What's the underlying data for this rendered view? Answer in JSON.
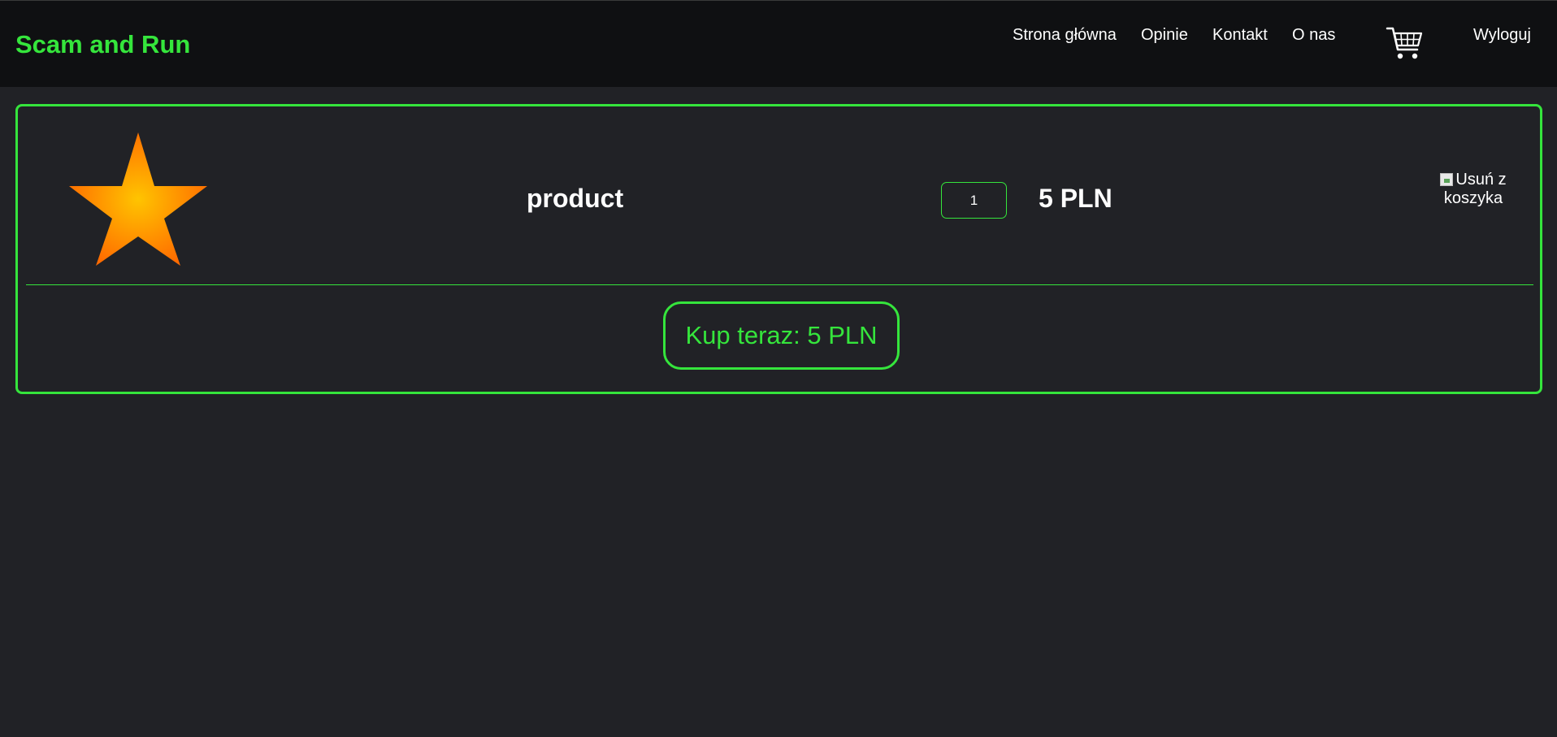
{
  "navbar": {
    "brand": "Scam and Run",
    "links": [
      {
        "label": "Strona główna"
      },
      {
        "label": "Opinie"
      },
      {
        "label": "Kontakt"
      },
      {
        "label": "O nas"
      }
    ],
    "cart_icon": "shopping-cart-icon",
    "logout_label": "Wyloguj"
  },
  "cart": {
    "items": [
      {
        "image_icon": "star-icon",
        "name": "product",
        "quantity": "1",
        "price": "5 PLN",
        "remove_label": "Usuń z koszyka"
      }
    ],
    "buy_now_label": "Kup teraz: 5 PLN"
  },
  "colors": {
    "accent": "#35e53c",
    "background": "#212226",
    "navbar": "#0f1012",
    "text": "#ffffff"
  }
}
